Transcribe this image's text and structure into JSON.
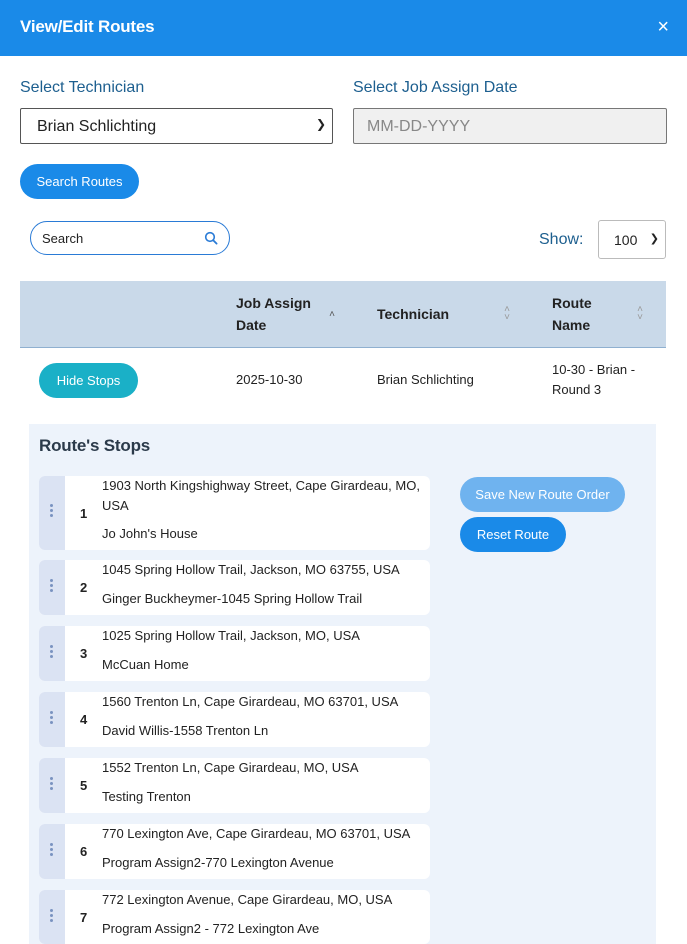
{
  "modal": {
    "title": "View/Edit Routes",
    "close_glyph": "×"
  },
  "filters": {
    "technician_label": "Select Technician",
    "technician_value": "Brian Schlichting",
    "date_label": "Select Job Assign Date",
    "date_placeholder": "MM-DD-YYYY",
    "search_routes_label": "Search Routes"
  },
  "table_controls": {
    "search_placeholder": "Search",
    "show_label": "Show:",
    "show_value": "100"
  },
  "table": {
    "headers": {
      "date": "Job Assign Date",
      "technician": "Technician",
      "route": "Route Name"
    },
    "row": {
      "button": "Hide Stops",
      "date": "2025-10-30",
      "technician": "Brian Schlichting",
      "route": "10-30 - Brian - Round 3"
    }
  },
  "stops": {
    "title": "Route's Stops",
    "save_label": "Save New Route Order",
    "reset_label": "Reset Route",
    "items": [
      {
        "num": "1",
        "address": "1903 North Kingshighway Street, Cape Girardeau, MO, USA",
        "name": "Jo John's House"
      },
      {
        "num": "2",
        "address": "1045 Spring Hollow Trail, Jackson, MO 63755, USA",
        "name": "Ginger Buckheymer-1045 Spring Hollow Trail"
      },
      {
        "num": "3",
        "address": "1025 Spring Hollow Trail, Jackson, MO, USA",
        "name": "McCuan Home"
      },
      {
        "num": "4",
        "address": "1560 Trenton Ln, Cape Girardeau, MO 63701, USA",
        "name": "David Willis-1558 Trenton Ln"
      },
      {
        "num": "5",
        "address": "1552 Trenton Ln, Cape Girardeau, MO, USA",
        "name": "Testing Trenton"
      },
      {
        "num": "6",
        "address": "770 Lexington Ave, Cape Girardeau, MO 63701, USA",
        "name": "Program Assign2-770 Lexington Avenue"
      },
      {
        "num": "7",
        "address": "772 Lexington Avenue, Cape Girardeau, MO, USA",
        "name": "Program Assign2 - 772 Lexington Ave"
      }
    ]
  }
}
